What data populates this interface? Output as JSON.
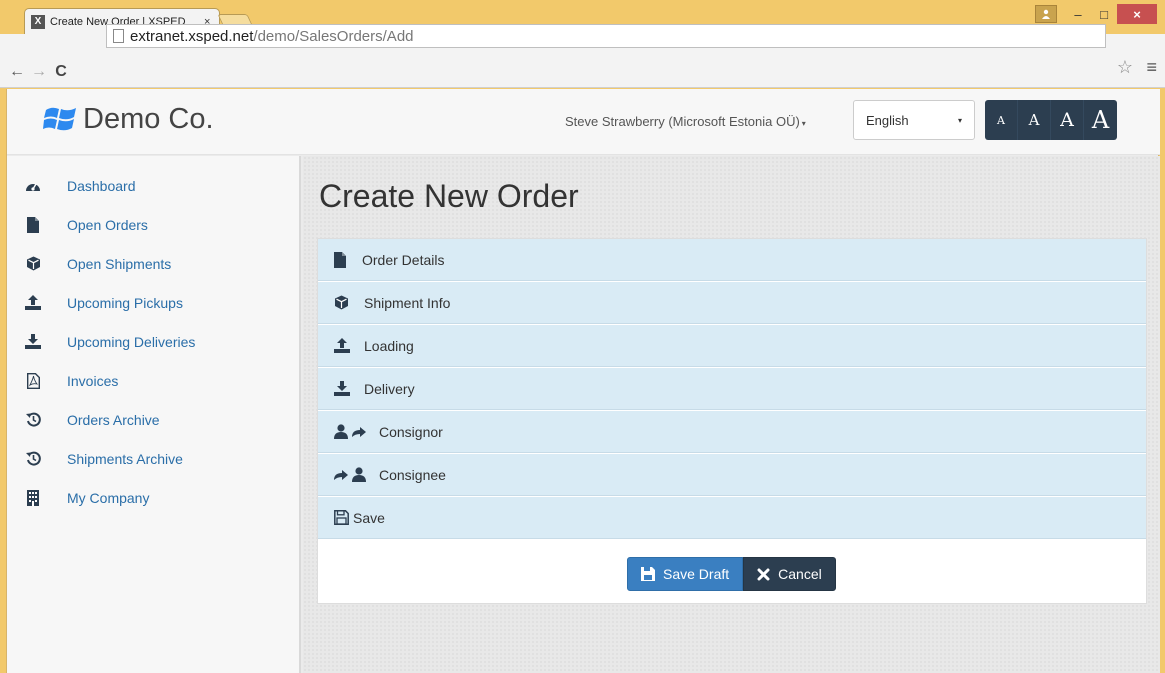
{
  "browser": {
    "tab_title": "Create New Order | XSPED",
    "tab_close": "×",
    "favicon_letter": "X",
    "url_host": "extranet.xsped.net",
    "url_path": "/demo/SalesOrders/Add",
    "star_glyph": "☆",
    "menu_glyph": "≡",
    "back_glyph": "←",
    "forward_glyph": "→",
    "reload_glyph": "C",
    "minimize_glyph": "–",
    "maximize_glyph": "□",
    "close_glyph": "×"
  },
  "header": {
    "brand": "Demo Co.",
    "user": "Steve Strawberry (Microsoft Estonia OÜ)",
    "language": "English",
    "font_sizes": [
      "A",
      "A",
      "A",
      "A"
    ],
    "caret": "▾"
  },
  "sidebar": {
    "items": [
      {
        "label": "Dashboard",
        "icon": "dashboard-icon"
      },
      {
        "label": "Open Orders",
        "icon": "file-icon"
      },
      {
        "label": "Open Shipments",
        "icon": "cube-icon"
      },
      {
        "label": "Upcoming Pickups",
        "icon": "upload-icon"
      },
      {
        "label": "Upcoming Deliveries",
        "icon": "download-icon"
      },
      {
        "label": "Invoices",
        "icon": "pdf-icon"
      },
      {
        "label": "Orders Archive",
        "icon": "history-icon"
      },
      {
        "label": "Shipments Archive",
        "icon": "history-icon"
      },
      {
        "label": "My Company",
        "icon": "building-icon"
      }
    ]
  },
  "main": {
    "title": "Create New Order",
    "sections": [
      {
        "label": "Order Details",
        "icon": "file-icon"
      },
      {
        "label": "Shipment Info",
        "icon": "cube-icon"
      },
      {
        "label": "Loading",
        "icon": "upload-icon"
      },
      {
        "label": "Delivery",
        "icon": "download-icon"
      },
      {
        "label": "Consignor",
        "icon": "user-share-icon"
      },
      {
        "label": "Consignee",
        "icon": "share-user-icon"
      },
      {
        "label": "Save",
        "icon": "floppy-outline-icon"
      }
    ],
    "save_draft": "Save Draft",
    "cancel": "Cancel"
  },
  "colors": {
    "link": "#2a6ea8",
    "section_bg": "#d9ebf5",
    "primary": "#3a7fc1",
    "dark": "#2c3e50",
    "frame": "#f2c96b"
  }
}
